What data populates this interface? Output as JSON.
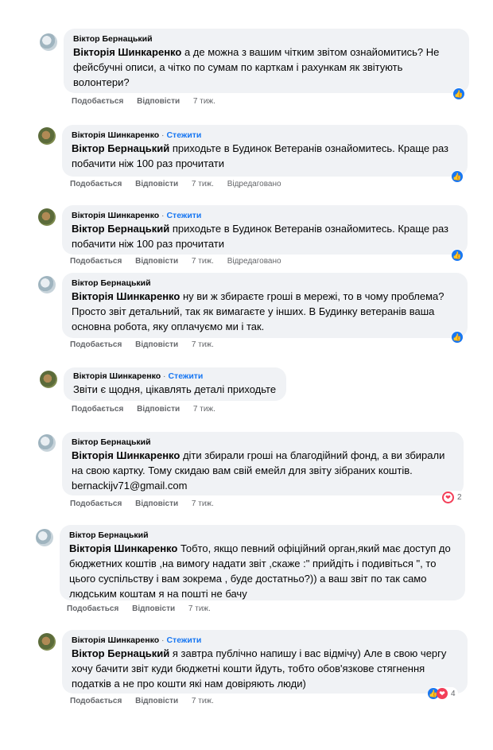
{
  "comments": [
    {
      "author": "Віктор Бернацький",
      "follow": "",
      "mention": "Вікторія Шинкаренко",
      "text": " а де можна з вашим чітким звітом ознайомитись? Не фейсбучні описи, а чітко по сумам по карткам і рахункам як звітують волонтери?",
      "like": "Подобається",
      "reply": "Відповісти",
      "time": "7 тиж.",
      "edited": "",
      "reactions": "",
      "reaction_icons": [
        "like"
      ]
    },
    {
      "author": "Вікторія Шинкаренко",
      "follow": "Стежити",
      "mention": "Віктор Бернацький",
      "text": " приходьте в Будинок Ветеранів ознайомитесь. Краще раз побачити ніж 100 раз прочитати",
      "like": "Подобається",
      "reply": "Відповісти",
      "time": "7 тиж.",
      "edited": "Відредаговано",
      "reactions": "",
      "reaction_icons": [
        "like"
      ]
    },
    {
      "author": "Вікторія Шинкаренко",
      "follow": "Стежити",
      "mention": "Віктор Бернацький",
      "text": " приходьте в Будинок Ветеранів ознайомитесь. Краще раз побачити ніж 100 раз прочитати",
      "like": "Подобається",
      "reply": "Відповісти",
      "time": "7 тиж.",
      "edited": "Відредаговано",
      "reactions": "",
      "reaction_icons": [
        "like"
      ]
    },
    {
      "author": "Віктор Бернацький",
      "follow": "",
      "mention": "Вікторія Шинкаренко",
      "text": " ну ви ж збираєте гроші в мережі, то в чому проблема? Просто звіт детальний, так як вимагаєте у інших. В Будинку ветеранів ваша основна робота, яку оплачуємо ми і так.",
      "like": "Подобається",
      "reply": "Відповісти",
      "time": "7 тиж.",
      "edited": "",
      "reactions": "",
      "reaction_icons": [
        "like"
      ]
    },
    {
      "author": "Вікторія Шинкаренко",
      "follow": "Стежити",
      "mention": "",
      "text": "Звіти є щодня, цікавлять деталі приходьте",
      "like": "Подобається",
      "reply": "Відповісти",
      "time": "7 тиж.",
      "edited": "",
      "reactions": "",
      "reaction_icons": []
    },
    {
      "author": "Віктор Бернацький",
      "follow": "",
      "mention": "Вікторія Шинкаренко",
      "text": " діти збирали гроші на благодійний фонд, а ви збирали на свою картку. Тому скидаю вам свій емейл для звіту зібраних коштів. bernackijv71@gmail.com",
      "like": "Подобається",
      "reply": "Відповісти",
      "time": "7 тиж.",
      "edited": "",
      "reactions": "2",
      "reaction_icons": [
        "love-outline"
      ]
    },
    {
      "author": "Віктор Бернацький",
      "follow": "",
      "mention": "Вікторія Шинкаренко",
      "text": " Тобто, якщо певний офіційний орган,який має доступ до бюджетних коштів ,на вимогу надати звіт ,скаже :\" прийдіть і подивіться \", то цього суспільству і вам зокрема , буде достатньо?)) а ваш звіт по так само людським коштам я на пошті не бачу",
      "like": "Подобається",
      "reply": "Відповісти",
      "time": "7 тиж.",
      "edited": "",
      "reactions": "",
      "reaction_icons": []
    },
    {
      "author": "Вікторія Шинкаренко",
      "follow": "Стежити",
      "mention": "Віктор Бернацький",
      "text": " я завтра публічно напишу і вас відмічу) Але в свою чергу хочу бачити звіт куди бюджетні кошти йдуть, тобто обов'язкове стягнення податків а не про кошти які нам довіряють люди)",
      "like": "Подобається",
      "reply": "Відповісти",
      "time": "7 тиж.",
      "edited": "",
      "reactions": "4",
      "reaction_icons": [
        "like",
        "love"
      ]
    }
  ]
}
